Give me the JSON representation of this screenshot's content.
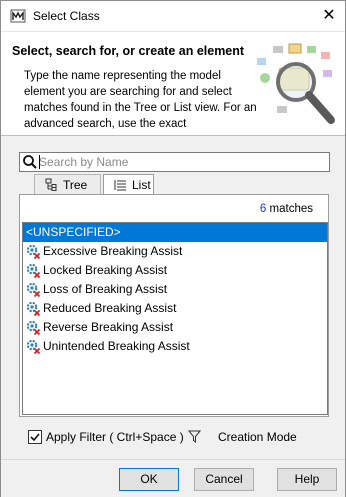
{
  "window": {
    "title": "Select Class"
  },
  "header": {
    "title": "Select, search for, or create an element",
    "description": "Type the name representing the model element you are searching for and select matches found in the Tree or List view. For an advanced search, use the exact"
  },
  "search": {
    "placeholder": "Search by Name",
    "value": ""
  },
  "tabs": [
    {
      "label": "Tree",
      "icon": "tree-icon"
    },
    {
      "label": "List",
      "icon": "list-icon",
      "active": true
    }
  ],
  "results": {
    "count": "6",
    "matches_label": " matches",
    "items": [
      {
        "label": "<UNSPECIFIED>",
        "selected": true
      },
      {
        "label": "Excessive Breaking Assist",
        "icon": "class-error-icon"
      },
      {
        "label": "Locked Breaking Assist",
        "icon": "class-error-icon"
      },
      {
        "label": "Loss of Breaking Assist",
        "icon": "class-error-icon"
      },
      {
        "label": "Reduced Breaking Assist",
        "icon": "class-error-icon"
      },
      {
        "label": "Reverse Breaking Assist",
        "icon": "class-error-icon"
      },
      {
        "label": "Unintended Breaking Assist",
        "icon": "class-error-icon"
      }
    ]
  },
  "options": {
    "apply_filter_label": "Apply Filter ( Ctrl+Space )",
    "apply_filter_checked": true,
    "creation_mode_label": "Creation Mode"
  },
  "buttons": {
    "ok": "OK",
    "cancel": "Cancel",
    "help": "Help"
  },
  "colors": {
    "selection": "#0078d7",
    "match_count": "#1a3dbf"
  }
}
